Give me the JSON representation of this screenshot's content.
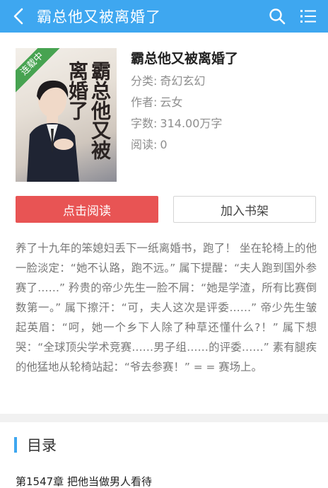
{
  "header": {
    "title": "霸总他又被离婚了",
    "back_icon": "chevron-left-icon",
    "search_icon": "search-icon",
    "menu_icon": "list-menu-icon",
    "bar_color": "#3ea7f0"
  },
  "book": {
    "ribbon": "连载中",
    "cover_title": "霸总他又被离婚了",
    "title": "霸总他又被离婚了",
    "category_label": "分类:",
    "category": "奇幻玄幻",
    "author_label": "作者:",
    "author": "云女",
    "words_label": "字数:",
    "words": "314.00万字",
    "reads_label": "阅读:",
    "reads": "0"
  },
  "actions": {
    "read_label": "点击阅读",
    "shelf_label": "加入书架",
    "read_color": "#e85454"
  },
  "intro": "养了十九年的笨媳妇丢下一纸离婚书，跑了！ 坐在轮椅上的他一脸淡定：“她不认路，跑不远。” 属下提醒：“夫人跑到国外参赛了……” 矜贵的帝少先生一脸不屑：“她是学渣，所有比赛倒数第一。” 属下擦汗：“可，夫人这次是评委……” 帝少先生皱起英眉：“呵，她一个乡下人除了种草还懂什么?！” 属下想哭：“全球顶尖学术竞赛……男子组……的评委……” 素有腿疾的他猛地从轮椅站起：“爷去参赛！” = = 赛场上。",
  "toc": {
    "title": "目录",
    "chapters": [
      "第1547章 把他当做男人看待"
    ]
  }
}
